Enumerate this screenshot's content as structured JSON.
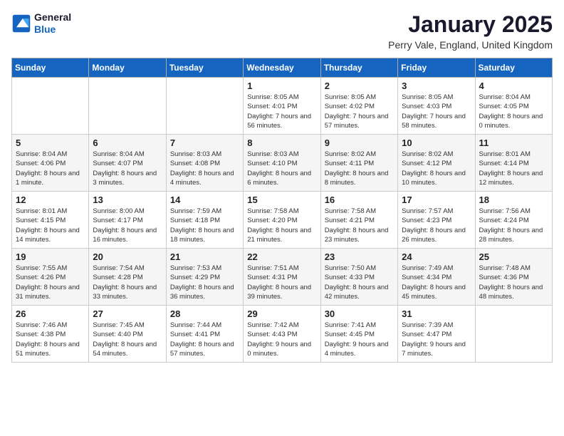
{
  "logo": {
    "line1": "General",
    "line2": "Blue"
  },
  "title": "January 2025",
  "location": "Perry Vale, England, United Kingdom",
  "days_of_week": [
    "Sunday",
    "Monday",
    "Tuesday",
    "Wednesday",
    "Thursday",
    "Friday",
    "Saturday"
  ],
  "weeks": [
    [
      {
        "day": "",
        "info": ""
      },
      {
        "day": "",
        "info": ""
      },
      {
        "day": "",
        "info": ""
      },
      {
        "day": "1",
        "info": "Sunrise: 8:05 AM\nSunset: 4:01 PM\nDaylight: 7 hours and 56 minutes."
      },
      {
        "day": "2",
        "info": "Sunrise: 8:05 AM\nSunset: 4:02 PM\nDaylight: 7 hours and 57 minutes."
      },
      {
        "day": "3",
        "info": "Sunrise: 8:05 AM\nSunset: 4:03 PM\nDaylight: 7 hours and 58 minutes."
      },
      {
        "day": "4",
        "info": "Sunrise: 8:04 AM\nSunset: 4:05 PM\nDaylight: 8 hours and 0 minutes."
      }
    ],
    [
      {
        "day": "5",
        "info": "Sunrise: 8:04 AM\nSunset: 4:06 PM\nDaylight: 8 hours and 1 minute."
      },
      {
        "day": "6",
        "info": "Sunrise: 8:04 AM\nSunset: 4:07 PM\nDaylight: 8 hours and 3 minutes."
      },
      {
        "day": "7",
        "info": "Sunrise: 8:03 AM\nSunset: 4:08 PM\nDaylight: 8 hours and 4 minutes."
      },
      {
        "day": "8",
        "info": "Sunrise: 8:03 AM\nSunset: 4:10 PM\nDaylight: 8 hours and 6 minutes."
      },
      {
        "day": "9",
        "info": "Sunrise: 8:02 AM\nSunset: 4:11 PM\nDaylight: 8 hours and 8 minutes."
      },
      {
        "day": "10",
        "info": "Sunrise: 8:02 AM\nSunset: 4:12 PM\nDaylight: 8 hours and 10 minutes."
      },
      {
        "day": "11",
        "info": "Sunrise: 8:01 AM\nSunset: 4:14 PM\nDaylight: 8 hours and 12 minutes."
      }
    ],
    [
      {
        "day": "12",
        "info": "Sunrise: 8:01 AM\nSunset: 4:15 PM\nDaylight: 8 hours and 14 minutes."
      },
      {
        "day": "13",
        "info": "Sunrise: 8:00 AM\nSunset: 4:17 PM\nDaylight: 8 hours and 16 minutes."
      },
      {
        "day": "14",
        "info": "Sunrise: 7:59 AM\nSunset: 4:18 PM\nDaylight: 8 hours and 18 minutes."
      },
      {
        "day": "15",
        "info": "Sunrise: 7:58 AM\nSunset: 4:20 PM\nDaylight: 8 hours and 21 minutes."
      },
      {
        "day": "16",
        "info": "Sunrise: 7:58 AM\nSunset: 4:21 PM\nDaylight: 8 hours and 23 minutes."
      },
      {
        "day": "17",
        "info": "Sunrise: 7:57 AM\nSunset: 4:23 PM\nDaylight: 8 hours and 26 minutes."
      },
      {
        "day": "18",
        "info": "Sunrise: 7:56 AM\nSunset: 4:24 PM\nDaylight: 8 hours and 28 minutes."
      }
    ],
    [
      {
        "day": "19",
        "info": "Sunrise: 7:55 AM\nSunset: 4:26 PM\nDaylight: 8 hours and 31 minutes."
      },
      {
        "day": "20",
        "info": "Sunrise: 7:54 AM\nSunset: 4:28 PM\nDaylight: 8 hours and 33 minutes."
      },
      {
        "day": "21",
        "info": "Sunrise: 7:53 AM\nSunset: 4:29 PM\nDaylight: 8 hours and 36 minutes."
      },
      {
        "day": "22",
        "info": "Sunrise: 7:51 AM\nSunset: 4:31 PM\nDaylight: 8 hours and 39 minutes."
      },
      {
        "day": "23",
        "info": "Sunrise: 7:50 AM\nSunset: 4:33 PM\nDaylight: 8 hours and 42 minutes."
      },
      {
        "day": "24",
        "info": "Sunrise: 7:49 AM\nSunset: 4:34 PM\nDaylight: 8 hours and 45 minutes."
      },
      {
        "day": "25",
        "info": "Sunrise: 7:48 AM\nSunset: 4:36 PM\nDaylight: 8 hours and 48 minutes."
      }
    ],
    [
      {
        "day": "26",
        "info": "Sunrise: 7:46 AM\nSunset: 4:38 PM\nDaylight: 8 hours and 51 minutes."
      },
      {
        "day": "27",
        "info": "Sunrise: 7:45 AM\nSunset: 4:40 PM\nDaylight: 8 hours and 54 minutes."
      },
      {
        "day": "28",
        "info": "Sunrise: 7:44 AM\nSunset: 4:41 PM\nDaylight: 8 hours and 57 minutes."
      },
      {
        "day": "29",
        "info": "Sunrise: 7:42 AM\nSunset: 4:43 PM\nDaylight: 9 hours and 0 minutes."
      },
      {
        "day": "30",
        "info": "Sunrise: 7:41 AM\nSunset: 4:45 PM\nDaylight: 9 hours and 4 minutes."
      },
      {
        "day": "31",
        "info": "Sunrise: 7:39 AM\nSunset: 4:47 PM\nDaylight: 9 hours and 7 minutes."
      },
      {
        "day": "",
        "info": ""
      }
    ]
  ]
}
